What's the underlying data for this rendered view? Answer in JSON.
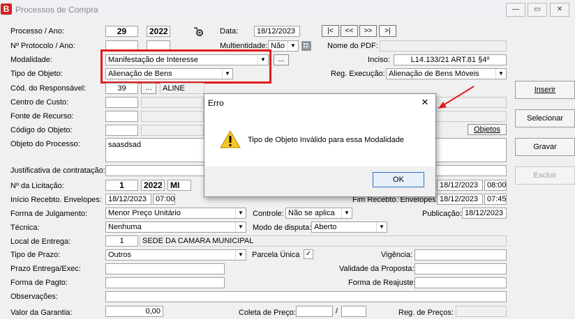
{
  "window": {
    "title": "Processos de Compra",
    "app_icon": "B",
    "controls": [
      "—",
      "▭",
      "✕"
    ]
  },
  "header": {
    "processo_label": "Processo / Ano:",
    "processo_num": "29",
    "processo_ano": "2022",
    "data_label": "Data:",
    "data_value": "18/12/2023",
    "nav": [
      "|<",
      "<<",
      ">>",
      ">|"
    ],
    "protocolo_label": "Nº Protocolo / Ano:",
    "multientidade_label": "Multientidade:",
    "multientidade_value": "Não",
    "nome_pdf_label": "Nome do PDF:"
  },
  "form": {
    "modalidade_label": "Modalidade:",
    "modalidade_value": "Manifestação de Interesse",
    "inciso_label": "Inciso:",
    "inciso_value": "L14.133/21 ART.81 §4º",
    "tipo_objeto_label": "Tipo de Objeto:",
    "tipo_objeto_value": "Alienação de Bens",
    "reg_execucao_label": "Reg. Execução:",
    "reg_execucao_value": "Alienação de Bens Móveis",
    "cod_responsavel_label": "Cód. do Responsável:",
    "cod_responsavel_value": "39",
    "responsavel_name": "ALINE",
    "centro_custo_label": "Centro de Custo:",
    "fonte_recurso_label": "Fonte de Recurso:",
    "codigo_objeto_label": "Código do Objeto:",
    "objetos_button": "Objetos",
    "objeto_processo_label": "Objeto do Processo:",
    "objeto_processo_value": "saasdsad",
    "justificativa_label": "Justificativa de contratação:",
    "licitacao_label": "Nº da Licitação:",
    "licitacao_num": "1",
    "licitacao_ano": "2022",
    "licitacao_tipo": "MI",
    "date_right_1": "18/12/2023",
    "time_right_1": "08:00",
    "inicio_receb_label": "Início Recebto. Envelopes:",
    "inicio_receb_date": "18/12/2023",
    "inicio_receb_time": "07:00",
    "fim_receb_label": "Fim Recebto. Envelopes:",
    "fim_receb_date": "18/12/2023",
    "fim_receb_time": "07:45",
    "forma_julgamento_label": "Forma de Julgamento:",
    "forma_julgamento_value": "Menor Preço Unitário",
    "controle_label": "Controle:",
    "controle_value": "Não se aplica",
    "publicacao_label": "Publicação:",
    "publicacao_value": "18/12/2023",
    "tecnica_label": "Técnica:",
    "tecnica_value": "Nenhuma",
    "modo_disputa_label": "Modo de disputa:",
    "modo_disputa_value": "Aberto",
    "local_entrega_label": "Local de Entrega:",
    "local_entrega_code": "1",
    "local_entrega_name": "SEDE DA CAMARA MUNICIPAL",
    "tipo_prazo_label": "Tipo de Prazo:",
    "tipo_prazo_value": "Outros",
    "parcela_unica_label": "Parcela Única",
    "parcela_unica_check": "✓",
    "vigencia_label": "Vigência:",
    "prazo_entrega_label": "Prazo Entrega/Exec:",
    "validade_proposta_label": "Validade da Proposta:",
    "forma_pagto_label": "Forma de Pagto:",
    "forma_reajuste_label": "Forma de Reajuste:",
    "observacoes_label": "Observações:",
    "valor_garantia_label": "Valor da Garantia:",
    "valor_garantia_value": "0,00",
    "coleta_preco_label": "Coleta de Preço:",
    "coleta_sep": "/",
    "reg_precos_label": "Reg. de Preços:"
  },
  "side_buttons": {
    "inserir": "Inserir",
    "selecionar": "Selecionar",
    "gravar": "Gravar",
    "excluir": "Excluir"
  },
  "dialog": {
    "title": "Erro",
    "message": "Tipo de Objeto Inválido para essa Modalidade",
    "ok": "OK",
    "close": "✕"
  },
  "colors": {
    "highlight": "#e01c1c",
    "app_icon": "#d0231f"
  }
}
